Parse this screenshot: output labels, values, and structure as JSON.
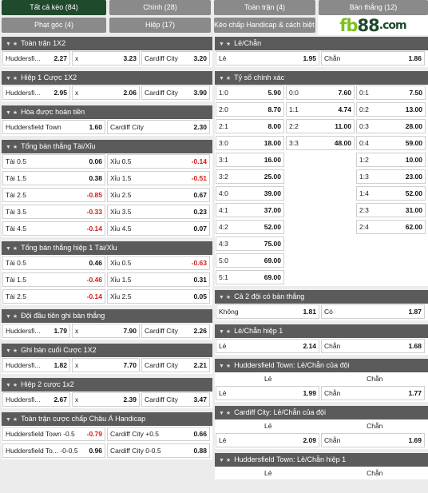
{
  "tabs": [
    {
      "label": "Tất cả kèo (84)"
    },
    {
      "label": "Chính (28)"
    },
    {
      "label": "Toàn trận (4)"
    },
    {
      "label": "Bàn thắng (12)"
    },
    {
      "label": "Phạt góc (4)"
    },
    {
      "label": "Hiệp (17)"
    },
    {
      "label": "Kèo chấp Handicap & cách biệt (3)"
    }
  ],
  "logo": {
    "fb": "fb",
    "num": "88",
    "dom": ".com"
  },
  "colors": {
    "header": "#5b5b5b",
    "active_tab": "#1f4a2c",
    "tab": "#8a8a8a",
    "negative": "#d41a1a",
    "brand_green": "#7dc11f"
  },
  "left": [
    {
      "title": "Toàn trận 1X2",
      "rows": [
        [
          [
            "Huddersfi...",
            "2.27"
          ],
          [
            "x",
            "3.23"
          ],
          [
            "Cardiff City",
            "3.20"
          ]
        ]
      ]
    },
    {
      "title": "Hiệp 1 Cược 1X2",
      "rows": [
        [
          [
            "Huddersfi...",
            "2.95"
          ],
          [
            "x",
            "2.06"
          ],
          [
            "Cardiff City",
            "3.90"
          ]
        ]
      ]
    },
    {
      "title": "Hòa được hoàn tiền",
      "rows": [
        [
          [
            "Huddersfield Town",
            "1.60"
          ],
          [
            "Cardiff City",
            "2.30"
          ]
        ]
      ]
    },
    {
      "title": "Tổng bàn thắng Tài/Xỉu",
      "rows": [
        [
          [
            "Tài 0.5",
            "0.06"
          ],
          [
            "Xỉu 0.5",
            "-0.14"
          ]
        ],
        [
          [
            "Tài 1.5",
            "0.38"
          ],
          [
            "Xỉu 1.5",
            "-0.51"
          ]
        ],
        [
          [
            "Tài 2.5",
            "-0.85"
          ],
          [
            "Xỉu 2.5",
            "0.67"
          ]
        ],
        [
          [
            "Tài 3.5",
            "-0.33"
          ],
          [
            "Xỉu 3.5",
            "0.23"
          ]
        ],
        [
          [
            "Tài 4.5",
            "-0.14"
          ],
          [
            "Xỉu 4.5",
            "0.07"
          ]
        ]
      ]
    },
    {
      "title": "Tổng bàn thắng hiệp 1 Tài/Xỉu",
      "rows": [
        [
          [
            "Tài 0.5",
            "0.46"
          ],
          [
            "Xỉu 0.5",
            "-0.63"
          ]
        ],
        [
          [
            "Tài 1.5",
            "-0.46"
          ],
          [
            "Xỉu 1.5",
            "0.31"
          ]
        ],
        [
          [
            "Tài 2.5",
            "-0.14"
          ],
          [
            "Xỉu 2.5",
            "0.05"
          ]
        ]
      ]
    },
    {
      "title": "Đội đầu tiên ghi bàn thắng",
      "rows": [
        [
          [
            "Huddersfi...",
            "1.79"
          ],
          [
            "x",
            "7.90"
          ],
          [
            "Cardiff City",
            "2.26"
          ]
        ]
      ]
    },
    {
      "title": "Ghi bàn cuối Cược 1X2",
      "rows": [
        [
          [
            "Huddersfi...",
            "1.82"
          ],
          [
            "x",
            "7.70"
          ],
          [
            "Cardiff City",
            "2.21"
          ]
        ]
      ]
    },
    {
      "title": "Hiệp 2 cược 1x2",
      "rows": [
        [
          [
            "Huddersfi...",
            "2.67"
          ],
          [
            "x",
            "2.39"
          ],
          [
            "Cardiff City",
            "3.47"
          ]
        ]
      ]
    },
    {
      "title": "Toàn trận cược chấp Châu Á Handicap",
      "rows": [
        [
          [
            "Huddersfield Town -0.5",
            "-0.79"
          ],
          [
            "Cardiff City +0.5",
            "0.66"
          ]
        ],
        [
          [
            "Huddersfield To... -0-0.5",
            "0.96"
          ],
          [
            "Cardiff City 0-0.5",
            "0.88"
          ]
        ]
      ]
    }
  ],
  "right": [
    {
      "title": "Lẻ/Chẵn",
      "rows": [
        [
          [
            "Lẻ",
            "1.95"
          ],
          [
            "Chẵn",
            "1.86"
          ]
        ]
      ]
    },
    {
      "title": "Tỷ số chính xác",
      "rows": [
        [
          [
            "1:0",
            "5.90"
          ],
          [
            "0:0",
            "7.60"
          ],
          [
            "0:1",
            "7.50"
          ]
        ],
        [
          [
            "2:0",
            "8.70"
          ],
          [
            "1:1",
            "4.74"
          ],
          [
            "0:2",
            "13.00"
          ]
        ],
        [
          [
            "2:1",
            "8.00"
          ],
          [
            "2:2",
            "11.00"
          ],
          [
            "0:3",
            "28.00"
          ]
        ],
        [
          [
            "3:0",
            "18.00"
          ],
          [
            "3:3",
            "48.00"
          ],
          [
            "0:4",
            "59.00"
          ]
        ],
        [
          [
            "3:1",
            "16.00"
          ],
          null,
          [
            "1:2",
            "10.00"
          ]
        ],
        [
          [
            "3:2",
            "25.00"
          ],
          null,
          [
            "1:3",
            "23.00"
          ]
        ],
        [
          [
            "4:0",
            "39.00"
          ],
          null,
          [
            "1:4",
            "52.00"
          ]
        ],
        [
          [
            "4:1",
            "37.00"
          ],
          null,
          [
            "2:3",
            "31.00"
          ]
        ],
        [
          [
            "4:2",
            "52.00"
          ],
          null,
          [
            "2:4",
            "62.00"
          ]
        ],
        [
          [
            "4:3",
            "75.00"
          ],
          null,
          null
        ],
        [
          [
            "5:0",
            "69.00"
          ],
          null,
          null
        ],
        [
          [
            "5:1",
            "69.00"
          ],
          null,
          null
        ]
      ]
    },
    {
      "title": "Cả 2 đội có bàn thắng",
      "rows": [
        [
          [
            "Không",
            "1.81"
          ],
          [
            "Có",
            "1.87"
          ]
        ]
      ]
    },
    {
      "title": "Lẻ/Chẵn hiệp 1",
      "rows": [
        [
          [
            "Lẻ",
            "2.14"
          ],
          [
            "Chẵn",
            "1.68"
          ]
        ]
      ]
    },
    {
      "title": "Huddersfield Town: Lẻ/Chẵn của đội",
      "sub": [
        "Lẻ",
        "Chẵn"
      ],
      "rows": [
        [
          [
            "Lẻ",
            "1.99"
          ],
          [
            "Chẵn",
            "1.77"
          ]
        ]
      ]
    },
    {
      "title": "Cardiff City: Lẻ/Chẵn của đội",
      "sub": [
        "Lẻ",
        "Chẵn"
      ],
      "rows": [
        [
          [
            "Lẻ",
            "2.09"
          ],
          [
            "Chẵn",
            "1.69"
          ]
        ]
      ]
    },
    {
      "title": "Huddersfield Town: Lẻ/Chẵn hiệp 1",
      "sub": [
        "Lẻ",
        "Chẵn"
      ],
      "rows": []
    }
  ]
}
